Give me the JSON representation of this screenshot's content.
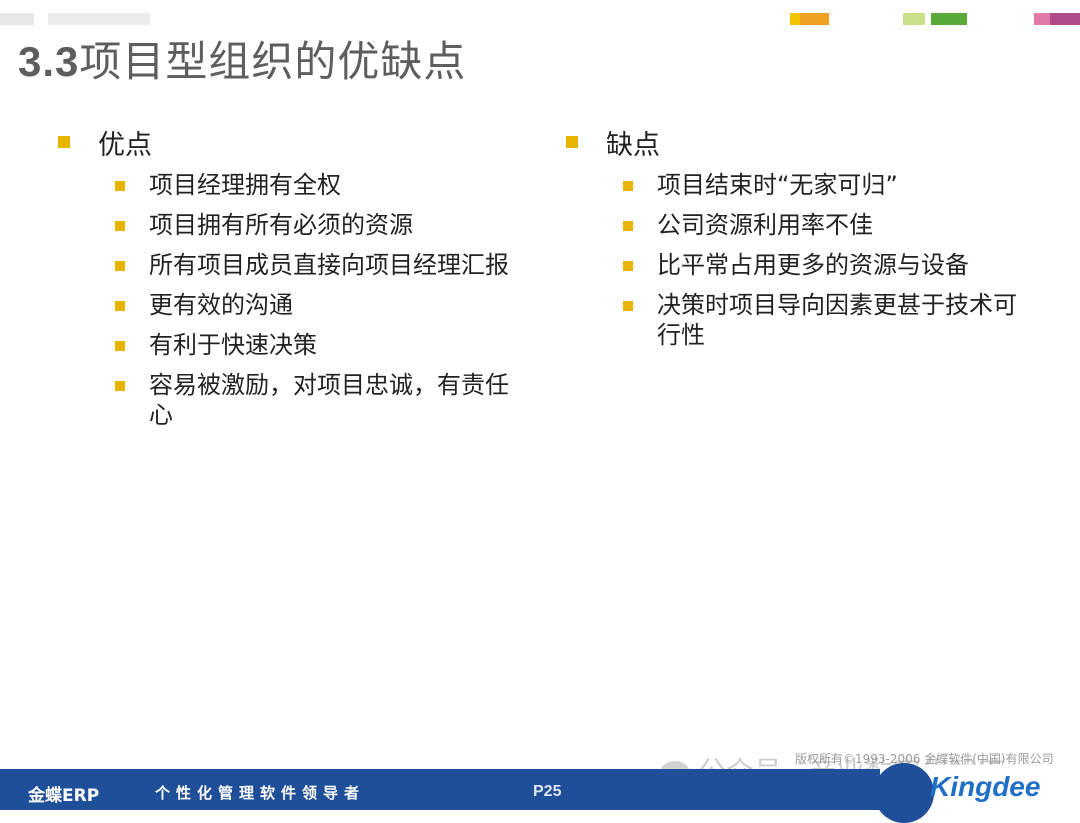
{
  "slide": {
    "title_number": "3.3",
    "title_text": "项目型组织的优缺点"
  },
  "pros": {
    "heading": "优点",
    "items": [
      "项目经理拥有全权",
      "项目拥有所有必须的资源",
      "所有项目成员直接向项目经理汇报",
      "更有效的沟通",
      "有利于快速决策",
      "容易被激励，对项目忠诚，有责任心"
    ]
  },
  "cons": {
    "heading": "缺点",
    "items": [
      "项目结束时“无家可归”",
      "公司资源利用率不佳",
      "比平常占用更多的资源与设备",
      "决策时项目导向因素更甚于技术可行性"
    ]
  },
  "footer": {
    "brand": "金蝶ERP",
    "slogan": "个性化管理软件领导者",
    "page": "P25",
    "copyright": "版权所有©1993-2006 金蝶软件(中国)有限公司",
    "logo": "Kingdee"
  },
  "watermark": {
    "text": "公众号 · 产业数字化智库",
    "icon": "wechat-icon"
  },
  "colors": {
    "bullet": "#e8b400",
    "footer_bar": "#1f4f98",
    "logo_text": "#1f6fc7",
    "title": "#5e5e5e"
  }
}
